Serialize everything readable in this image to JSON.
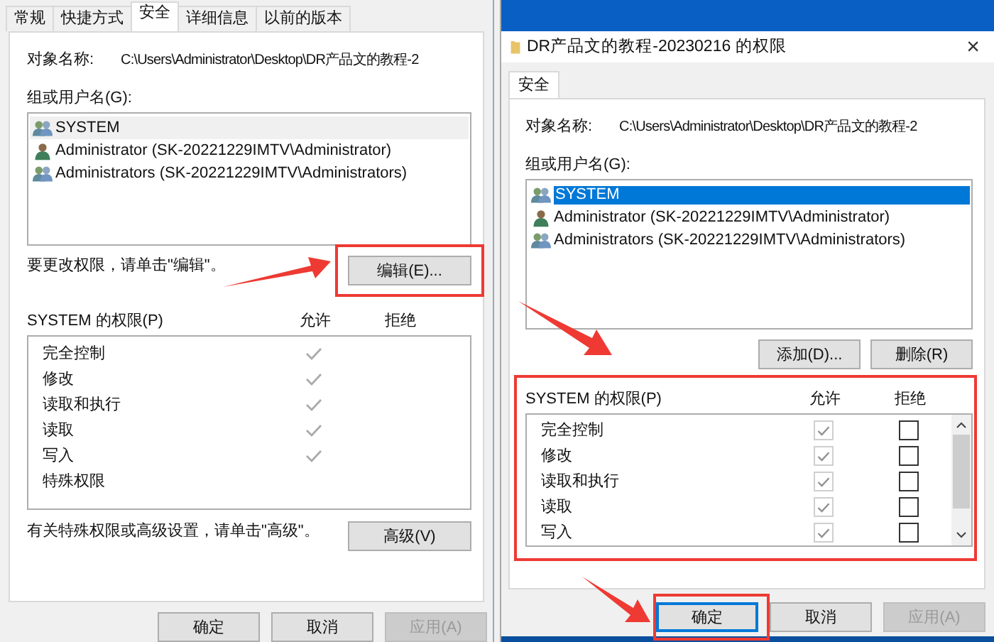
{
  "properties_window": {
    "tabs": [
      {
        "label": "常规",
        "selected": false
      },
      {
        "label": "快捷方式",
        "selected": false
      },
      {
        "label": "安全",
        "selected": true
      },
      {
        "label": "详细信息",
        "selected": false
      },
      {
        "label": "以前的版本",
        "selected": false
      }
    ],
    "object_label": "对象名称:",
    "object_path": "C:\\Users\\Administrator\\Desktop\\DR产品文的教程-2",
    "groups_label": "组或用户名(G):",
    "principals": [
      {
        "kind": "group",
        "name": "SYSTEM",
        "selected": true
      },
      {
        "kind": "user",
        "name": "Administrator (SK-20221229IMTV\\Administrator)",
        "selected": false
      },
      {
        "kind": "group",
        "name": "Administrators (SK-20221229IMTV\\Administrators)",
        "selected": false
      }
    ],
    "edit_hint": "要更改权限，请单击\"编辑\"。",
    "edit_button": "编辑(E)...",
    "permissions_label": "SYSTEM 的权限(P)",
    "allow_header": "允许",
    "deny_header": "拒绝",
    "permissions": [
      {
        "name": "完全控制",
        "allow": true,
        "deny": false
      },
      {
        "name": "修改",
        "allow": true,
        "deny": false
      },
      {
        "name": "读取和执行",
        "allow": true,
        "deny": false
      },
      {
        "name": "读取",
        "allow": true,
        "deny": false
      },
      {
        "name": "写入",
        "allow": true,
        "deny": false
      },
      {
        "name": "特殊权限",
        "allow": false,
        "deny": false
      }
    ],
    "advanced_hint": "有关特殊权限或高级设置，请单击\"高级\"。",
    "advanced_button": "高级(V)",
    "buttons": [
      {
        "label": "确定",
        "disabled": false
      },
      {
        "label": "取消",
        "disabled": false
      },
      {
        "label": "应用(A)",
        "disabled": true
      }
    ]
  },
  "permissions_window": {
    "title": "DR产品文的教程-20230216 的权限",
    "close": "×",
    "tabs": [
      {
        "label": "安全",
        "selected": true
      }
    ],
    "object_label": "对象名称:",
    "object_path": "C:\\Users\\Administrator\\Desktop\\DR产品文的教程-2",
    "groups_label": "组或用户名(G):",
    "principals": [
      {
        "kind": "group",
        "name": "SYSTEM",
        "selected": true
      },
      {
        "kind": "user",
        "name": "Administrator (SK-20221229IMTV\\Administrator)",
        "selected": false
      },
      {
        "kind": "group",
        "name": "Administrators (SK-20221229IMTV\\Administrators)",
        "selected": false
      }
    ],
    "add_button": "添加(D)...",
    "remove_button": "删除(R)",
    "permissions_label": "SYSTEM 的权限(P)",
    "allow_header": "允许",
    "deny_header": "拒绝",
    "permissions": [
      {
        "name": "完全控制",
        "allow": true,
        "allow_disabled": true,
        "deny": false
      },
      {
        "name": "修改",
        "allow": true,
        "allow_disabled": true,
        "deny": false
      },
      {
        "name": "读取和执行",
        "allow": true,
        "allow_disabled": true,
        "deny": false
      },
      {
        "name": "读取",
        "allow": true,
        "allow_disabled": true,
        "deny": false
      },
      {
        "name": "写入",
        "allow": true,
        "allow_disabled": true,
        "deny": false
      }
    ],
    "buttons": [
      {
        "label": "确定",
        "disabled": false
      },
      {
        "label": "取消",
        "disabled": false
      },
      {
        "label": "应用(A)",
        "disabled": true
      }
    ]
  }
}
